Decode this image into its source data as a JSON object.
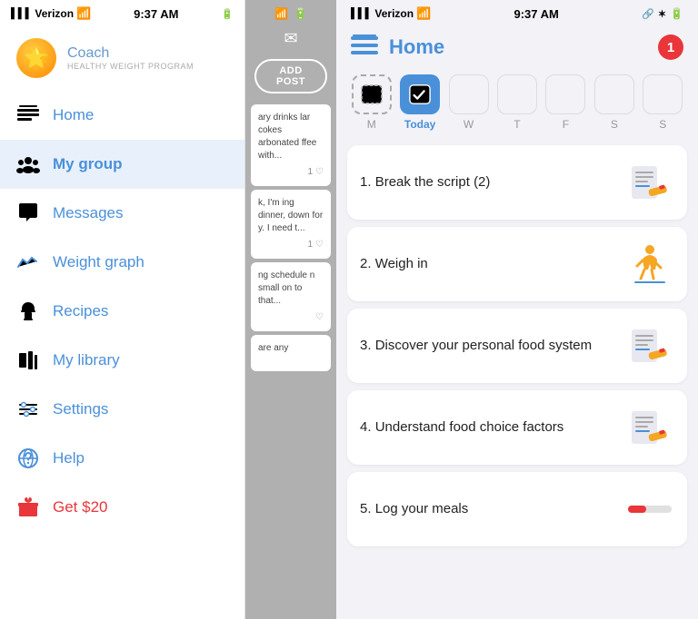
{
  "left": {
    "status": {
      "carrier": "Verizon",
      "time": "9:37 AM",
      "wifi": true,
      "signal": true
    },
    "coach": {
      "title": "Coach",
      "subtitle": "HEALTHY WEIGHT PROGRAM"
    },
    "nav": [
      {
        "id": "home",
        "label": "Home",
        "icon": "home-icon",
        "active": false
      },
      {
        "id": "my-group",
        "label": "My group",
        "icon": "group-icon",
        "active": true
      },
      {
        "id": "messages",
        "label": "Messages",
        "icon": "messages-icon",
        "active": false
      },
      {
        "id": "weight-graph",
        "label": "Weight graph",
        "icon": "weight-icon",
        "active": false
      },
      {
        "id": "recipes",
        "label": "Recipes",
        "icon": "recipes-icon",
        "active": false
      },
      {
        "id": "my-library",
        "label": "My library",
        "icon": "library-icon",
        "active": false
      },
      {
        "id": "settings",
        "label": "Settings",
        "icon": "settings-icon",
        "active": false
      },
      {
        "id": "help",
        "label": "Help",
        "icon": "help-icon",
        "active": false
      },
      {
        "id": "get-20",
        "label": "Get $20",
        "icon": "gift-icon",
        "active": false,
        "red": true
      }
    ]
  },
  "middle": {
    "add_post_label": "ADD POST",
    "posts": [
      {
        "text": "ary drinks lar cokes arbonated ffee with...",
        "likes": "1",
        "has_heart": true
      },
      {
        "text": "k, I'm ing dinner, down for y. I need t...",
        "likes": "1",
        "has_heart": true
      },
      {
        "text": "ng schedule n small on to that...",
        "likes": "",
        "has_heart": true
      },
      {
        "text": "are any",
        "likes": "",
        "has_heart": false
      }
    ]
  },
  "right": {
    "status": {
      "carrier": "Verizon",
      "time": "9:37 AM"
    },
    "header": {
      "title": "Home",
      "notification_count": "1"
    },
    "week": {
      "days": [
        {
          "label": "M",
          "selected": false,
          "dashed": false
        },
        {
          "label": "Today",
          "selected": true,
          "dashed": false
        },
        {
          "label": "W",
          "selected": false,
          "dashed": false
        },
        {
          "label": "T",
          "selected": false,
          "dashed": false
        },
        {
          "label": "F",
          "selected": false,
          "dashed": false
        },
        {
          "label": "S",
          "selected": false,
          "dashed": false
        },
        {
          "label": "S",
          "selected": false,
          "dashed": false
        }
      ]
    },
    "tasks": [
      {
        "number": "1",
        "label": "Break the script (2)",
        "icon": "pencil-note"
      },
      {
        "number": "2",
        "label": "Weigh in",
        "icon": "person-scale"
      },
      {
        "number": "3",
        "label": "Discover your personal food system",
        "icon": "pencil-note"
      },
      {
        "number": "4",
        "label": "Understand food choice factors",
        "icon": "pencil-note"
      },
      {
        "number": "5",
        "label": "Log your meals",
        "icon": "progress-bar"
      }
    ]
  }
}
